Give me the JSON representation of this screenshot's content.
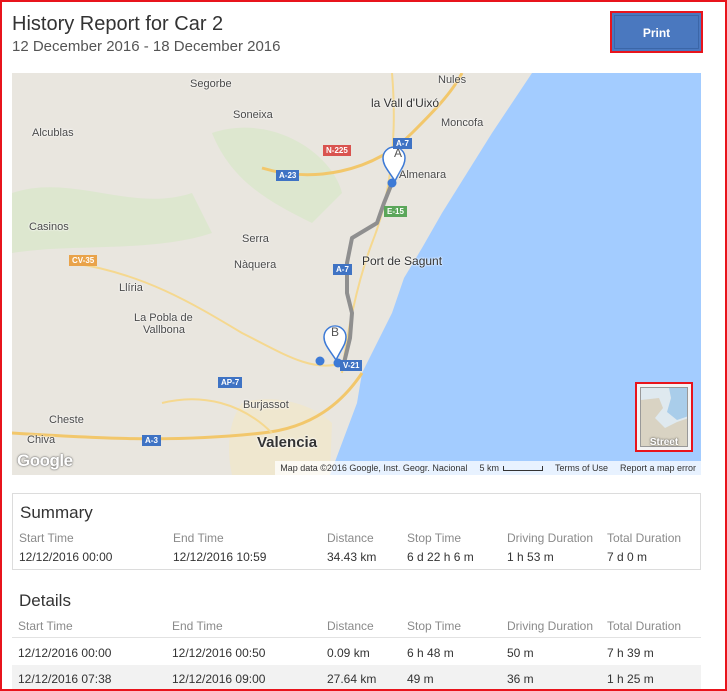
{
  "header": {
    "title": "History Report for Car 2",
    "date_range": "12 December 2016 - 18 December 2016",
    "print_label": "Print"
  },
  "map": {
    "places": {
      "nules": "Nules",
      "segorbe": "Segorbe",
      "vall_uixo": "la Vall d'Uixó",
      "moncofa": "Moncofa",
      "soneixa": "Soneixa",
      "alcublas": "Alcublas",
      "almenara": "Almenara",
      "casinos": "Casinos",
      "serra": "Serra",
      "nacquera": "Nàquera",
      "port_sagunt": "Port de Sagunt",
      "lliria": "Llíria",
      "pobla_vallbona_1": "La Pobla de",
      "pobla_vallbona_2": "Vallbona",
      "burjassot": "Burjassot",
      "cheste": "Cheste",
      "chiva": "Chiva",
      "valencia": "Valencia"
    },
    "shields": {
      "a7_top": "A-7",
      "n225": "N-225",
      "a23": "A-23",
      "e15": "E-15",
      "cv35": "CV-35",
      "a7_mid": "A-7",
      "v21": "V-21",
      "ap7": "AP-7",
      "a3": "A-3"
    },
    "markers": {
      "start": "A",
      "end": "B"
    },
    "google_logo": "Google",
    "map_data": "Map data ©2016 Google, Inst. Geogr. Nacional",
    "scale": "5 km",
    "terms": "Terms of Use",
    "report_error": "Report a map error",
    "street_label": "Street",
    "colors": {
      "water": "#a3ccff",
      "land": "#e9e6df",
      "route": "#8f8f8f",
      "marker": "#3d7ad6"
    }
  },
  "summary": {
    "title": "Summary",
    "columns": [
      "Start Time",
      "End Time",
      "Distance",
      "Stop Time",
      "Driving Duration",
      "Total Duration"
    ],
    "row": [
      "12/12/2016 00:00",
      "12/12/2016 10:59",
      "34.43 km",
      "6 d 22 h 6 m",
      "1 h 53 m",
      "7 d 0 m"
    ]
  },
  "details": {
    "title": "Details",
    "columns": [
      "Start Time",
      "End Time",
      "Distance",
      "Stop Time",
      "Driving Duration",
      "Total Duration"
    ],
    "rows": [
      [
        "12/12/2016 00:00",
        "12/12/2016 00:50",
        "0.09 km",
        "6 h 48 m",
        "50 m",
        "7 h 39 m"
      ],
      [
        "12/12/2016 07:38",
        "12/12/2016 09:00",
        "27.64 km",
        "49 m",
        "36 m",
        "1 h 25 m"
      ]
    ]
  }
}
